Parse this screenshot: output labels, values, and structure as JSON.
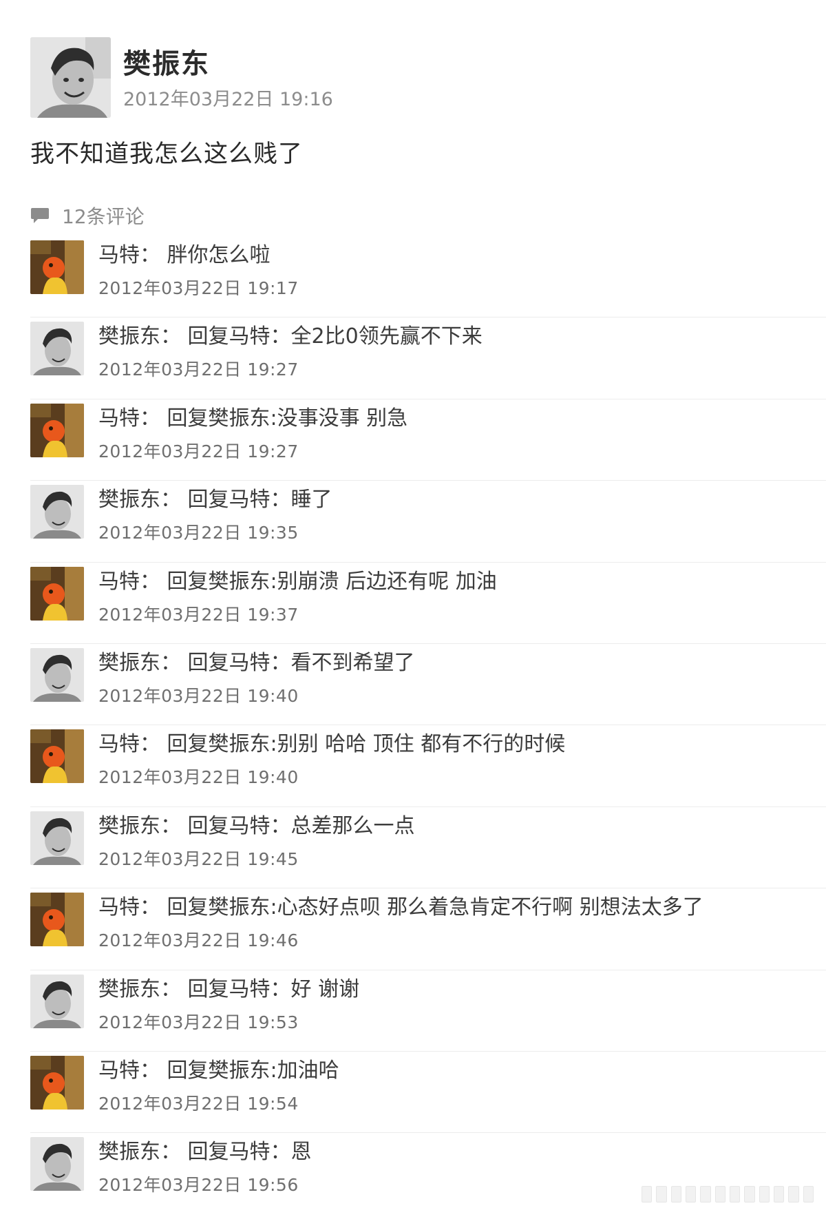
{
  "post": {
    "author": "樊振东",
    "time": "2012年03月22日 19:16",
    "content": "我不知道我怎么这么贱了",
    "avatar_icon": "person-avatar-grayscale"
  },
  "comment_count": {
    "icon": "comment-bubble-icon",
    "label": "12条评论"
  },
  "comments": [
    {
      "author": "马特",
      "text": "马特：  胖你怎么啦",
      "time": "2012年03月22日 19:17",
      "avatar": "cartoon-avatar"
    },
    {
      "author": "樊振东",
      "text": "樊振东：  回复马特：全2比0领先赢不下来",
      "time": "2012年03月22日 19:27",
      "avatar": "person-avatar"
    },
    {
      "author": "马特",
      "text": "马特：  回复樊振东:没事没事 别急",
      "time": "2012年03月22日 19:27",
      "avatar": "cartoon-avatar"
    },
    {
      "author": "樊振东",
      "text": "樊振东：  回复马特：睡了",
      "time": "2012年03月22日 19:35",
      "avatar": "person-avatar"
    },
    {
      "author": "马特",
      "text": "马特：  回复樊振东:别崩溃 后边还有呢 加油",
      "time": "2012年03月22日 19:37",
      "avatar": "cartoon-avatar"
    },
    {
      "author": "樊振东",
      "text": "樊振东：  回复马特：看不到希望了",
      "time": "2012年03月22日 19:40",
      "avatar": "person-avatar"
    },
    {
      "author": "马特",
      "text": "马特：  回复樊振东:别别 哈哈  顶住 都有不行的时候",
      "time": "2012年03月22日 19:40",
      "avatar": "cartoon-avatar"
    },
    {
      "author": "樊振东",
      "text": "樊振东：  回复马特：总差那么一点",
      "time": "2012年03月22日 19:45",
      "avatar": "person-avatar"
    },
    {
      "author": "马特",
      "text": "马特：  回复樊振东:心态好点呗 那么着急肯定不行啊 别想法太多了",
      "time": "2012年03月22日 19:46",
      "avatar": "cartoon-avatar"
    },
    {
      "author": "樊振东",
      "text": "樊振东：  回复马特：好 谢谢",
      "time": "2012年03月22日 19:53",
      "avatar": "person-avatar"
    },
    {
      "author": "马特",
      "text": "马特：  回复樊振东:加油哈",
      "time": "2012年03月22日 19:54",
      "avatar": "cartoon-avatar"
    },
    {
      "author": "樊振东",
      "text": "樊振东：  回复马特：恩",
      "time": "2012年03月22日 19:56",
      "avatar": "person-avatar"
    }
  ]
}
